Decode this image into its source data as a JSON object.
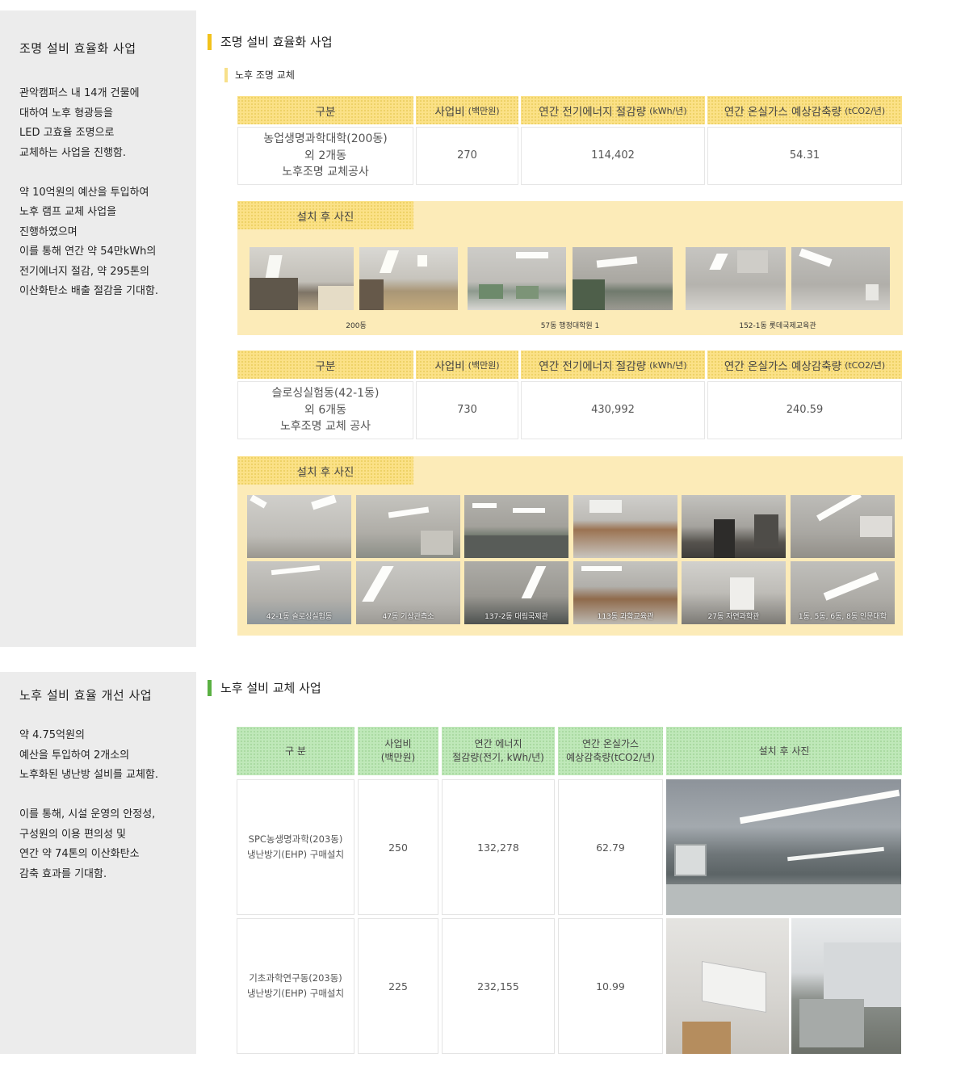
{
  "section1": {
    "sidebar_title": "조명 설비 효율화 사업",
    "sidebar_text": "관악캠퍼스 내 14개 건물에\n대하여 노후 형광등을\nLED 고효율 조명으로\n교체하는 사업을 진행함.\n\n약 10억원의 예산을 투입하여\n노후 램프 교체 사업을\n진행하였으며\n이를 통해 연간 약 54만kWh의\n전기에너지 절감, 약 295톤의\n이산화탄소 배출 절감을 기대함.",
    "title": "조명 설비 효율화 사업",
    "subtitle": "노후 조명 교체",
    "headers": [
      {
        "main": "구분",
        "unit": ""
      },
      {
        "main": "사업비",
        "unit": "(백만원)"
      },
      {
        "main": "연간 전기에너지 절감량",
        "unit": "(kWh/년)"
      },
      {
        "main": "연간 온실가스 예상감축량",
        "unit": "(tCO2/년)"
      }
    ],
    "projects": [
      {
        "name_lines": [
          "농업생명과학대학(200동)",
          "외 2개동",
          "노후조명 교체공사"
        ],
        "cost": "270",
        "energy": "114,402",
        "ghg": "54.31",
        "photo_tab": "설치 후 사진",
        "captions": [
          "200동",
          "57동 행정대학원 1",
          "152-1동 롯데국제교육관"
        ]
      },
      {
        "name_lines": [
          "슬로싱실험동(42-1동)",
          "외 6개동",
          "노후조명 교체 공사"
        ],
        "cost": "730",
        "energy": "430,992",
        "ghg": "240.59",
        "photo_tab": "설치 후 사진",
        "captions": [
          "42-1동 슬로싱실험동",
          "47동 기상관측소",
          "137-2동 대림국제관",
          "113동 과학교육관",
          "27동 자연과학관",
          "1동, 5동, 6동, 8동 인문대학"
        ]
      }
    ]
  },
  "section2": {
    "sidebar_title": "노후 설비 효율 개선 사업",
    "sidebar_text": "약 4.75억원의\n예산을 투입하여 2개소의\n노후화된 냉난방 설비를 교체함.\n\n이를 통해, 시설 운영의 안정성,\n구성원의 이용 편의성 및\n연간 약 74톤의 이산화탄소\n감축 효과를 기대함.",
    "title": "노후 설비 교체 사업",
    "headers": [
      "구 분",
      "사업비\n(백만원)",
      "연간 에너지\n절감량(전기, kWh/년)",
      "연간 온실가스\n예상감축량(tCO2/년)",
      "설치 후 사진"
    ],
    "rows": [
      {
        "name": "SPC농생명과학(203동)\n냉난방기(EHP) 구매설치",
        "cost": "250",
        "energy": "132,278",
        "ghg": "62.79"
      },
      {
        "name": "기초과학연구동(203동)\n냉난방기(EHP) 구매설치",
        "cost": "225",
        "energy": "232,155",
        "ghg": "10.99"
      }
    ]
  },
  "colors": {
    "yellow_accent": "#f2c21c",
    "green_accent": "#5ab043",
    "photo_box_bg": "#fcebb8",
    "sidebar_bg": "#ececec"
  }
}
